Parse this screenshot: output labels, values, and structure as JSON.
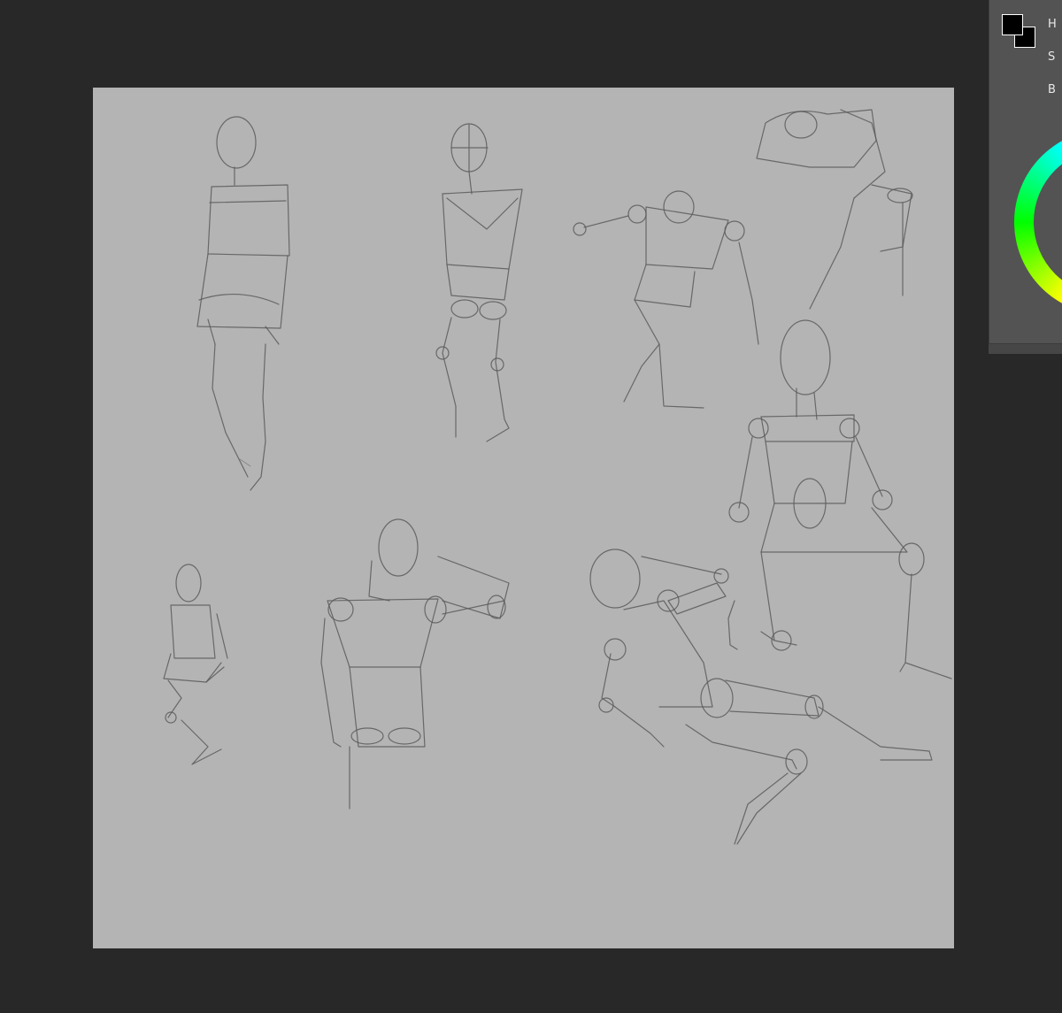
{
  "panel": {
    "hsb_labels": [
      "H",
      "S",
      "B"
    ],
    "foreground_color": "#000000",
    "background_color": "#000000"
  },
  "canvas": {
    "background": "#b4b4b4"
  },
  "colors": {
    "workspace": "#282828",
    "panel": "#535353"
  }
}
